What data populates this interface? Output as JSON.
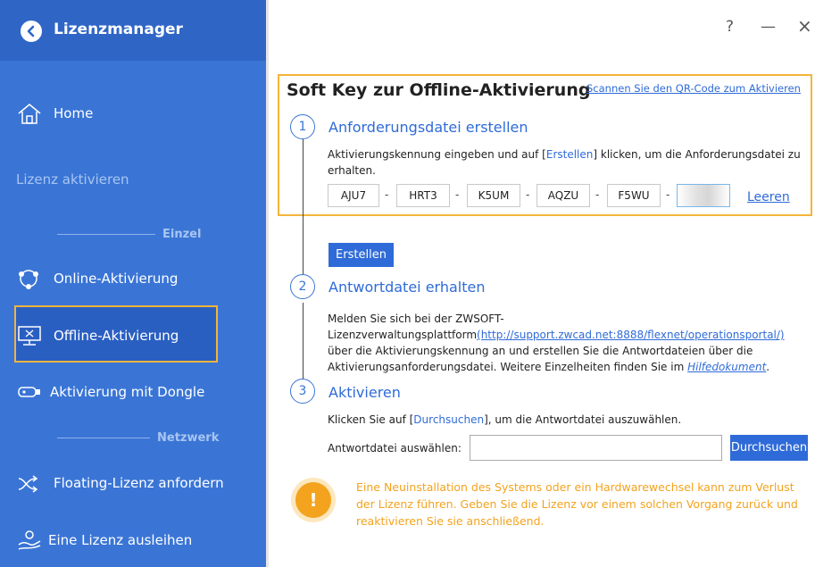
{
  "sidebar": {
    "title": "Lizenzmanager",
    "home": "Home",
    "section_activate": "Lizenz aktivieren",
    "divider_single": "Einzel",
    "online": "Online-Aktivierung",
    "offline": "Offline-Aktivierung",
    "dongle": "Aktivierung mit Dongle",
    "divider_network": "Netzwerk",
    "floating": "Floating-Lizenz anfordern",
    "borrow": "Eine Lizenz ausleihen",
    "icons": [
      "back-arrow-icon",
      "home-icon",
      "online-activation-icon",
      "monitor-icon",
      "dongle-icon",
      "floating-arrows-icon",
      "borrow-hand-icon"
    ],
    "colors": {
      "bg": "#3a75d6",
      "active_border": "#f3b53a"
    }
  },
  "window": {
    "help": "?",
    "minimize": "—",
    "close": "×"
  },
  "main": {
    "title": "Soft Key zur Offline-Aktivierung",
    "qr_link": "Scannen Sie den QR-Code zum Aktivieren",
    "step1": {
      "number": "1",
      "title": "Anforderungsdatei erstellen",
      "desc_pre": "Aktivierungskennung eingeben und auf [",
      "desc_link": "Erstellen",
      "desc_post": "] klicken, um die Anforderungsdatei zu erhalten.",
      "keys": [
        "AJU7",
        "HRT3",
        "K5UM",
        "AQZU",
        "F5WU",
        ""
      ],
      "clear": "Leeren",
      "create_button": "Erstellen"
    },
    "step2": {
      "number": "2",
      "title": "Antwortdatei erhalten",
      "desc_pre": "Melden Sie sich bei der ZWSOFT-Lizenzverwaltungsplattform",
      "link": "(http://support.zwcad.net:8888/flexnet/operationsportal/)",
      "desc_mid": " über die Aktivierungskennung an und erstellen Sie die Antwortdateien über die Aktivierungsanforderungsdatei. Weitere Einzelheiten finden Sie im ",
      "doc_link": "Hilfedokument",
      "desc_end": "."
    },
    "step3": {
      "number": "3",
      "title": "Aktivieren",
      "desc_pre": "Klicken Sie auf [",
      "desc_link": "Durchsuchen",
      "desc_post": "], um die Antwortdatei auszuwählen.",
      "file_label": "Antwortdatei auswählen:",
      "file_value": "",
      "browse_button": "Durchsuchen"
    },
    "warning": {
      "icon": "!",
      "text": "Eine Neuinstallation des Systems oder ein Hardwarewechsel kann zum Verlust der Lizenz führen. Geben Sie die Lizenz vor einem solchen Vorgang zurück und reaktivieren Sie sie anschließend."
    },
    "colors": {
      "accent": "#2f6bd8",
      "warning": "#f3a31d",
      "highlight": "#f3b53a"
    }
  }
}
